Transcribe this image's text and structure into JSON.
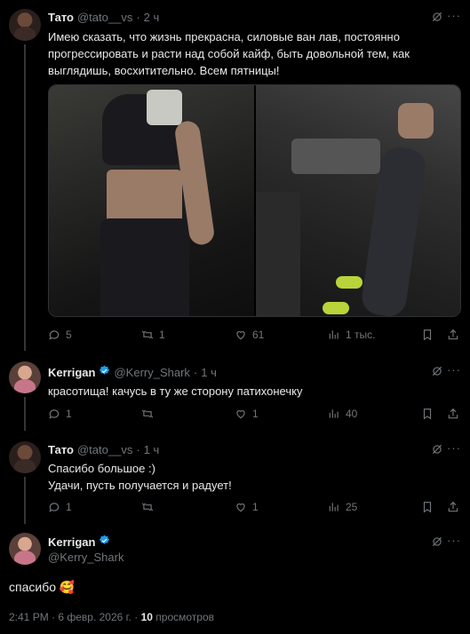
{
  "tweets": [
    {
      "name": "Тато",
      "handle": "@tato__vs",
      "time": "2 ч",
      "text": "Имею сказать, что жизнь прекрасна, силовые ван лав, постоянно прогрессировать и расти над собой кайф, быть довольной тем, как выглядишь, восхитительно. Всем пятницы!",
      "replies": "5",
      "reposts": "1",
      "likes": "61",
      "views": "1 тыс."
    },
    {
      "name": "Kerrigan",
      "handle": "@Kerry_Shark",
      "time": "1 ч",
      "text": "красотища! качусь в ту же сторону патихонечку",
      "replies": "1",
      "reposts": "",
      "likes": "1",
      "views": "40"
    },
    {
      "name": "Тато",
      "handle": "@tato__vs",
      "time": "1 ч",
      "text_line1": "Спасибо большое :)",
      "text_line2": "Удачи, пусть получается и радует!",
      "replies": "1",
      "reposts": "",
      "likes": "1",
      "views": "25"
    }
  ],
  "main": {
    "name": "Kerrigan",
    "handle": "@Kerry_Shark",
    "text": "спасибо",
    "emoji": "🥰",
    "timestamp": "2:41 PM · 6 февр. 2026 г. · ",
    "views_count": "10",
    "views_label": "просмотров"
  },
  "icons": [
    "grok-icon",
    "more-icon",
    "reply-icon",
    "repost-icon",
    "like-icon",
    "views-icon",
    "bookmark-icon",
    "share-icon",
    "verified-icon"
  ],
  "colors": {
    "background": "#000000",
    "text": "#e7e9ea",
    "secondary": "#71767b",
    "verified": "#1d9bf0"
  }
}
